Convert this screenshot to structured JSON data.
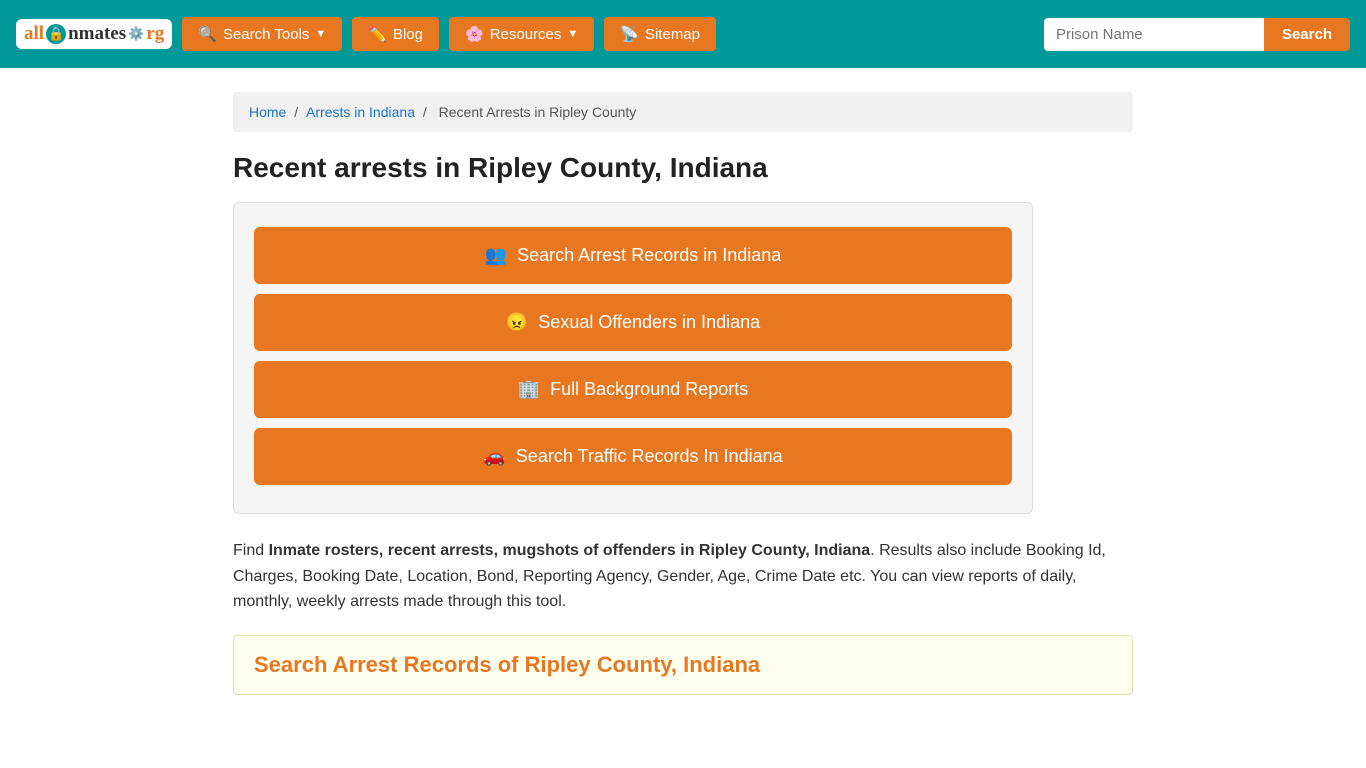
{
  "site": {
    "logo": {
      "all": "all",
      "inmates": "Inmates",
      "org": ".org"
    }
  },
  "navbar": {
    "search_tools_label": "Search Tools",
    "blog_label": "Blog",
    "resources_label": "Resources",
    "sitemap_label": "Sitemap",
    "search_placeholder": "Prison Name",
    "search_button": "Search"
  },
  "breadcrumb": {
    "home": "Home",
    "arrests_in_indiana": "Arrests in Indiana",
    "current": "Recent Arrests in Ripley County"
  },
  "page": {
    "title": "Recent arrests in Ripley County, Indiana"
  },
  "action_buttons": {
    "btn1": "Search Arrest Records in Indiana",
    "btn2": "Sexual Offenders in Indiana",
    "btn3": "Full Background Reports",
    "btn4": "Search Traffic Records In Indiana"
  },
  "description": {
    "intro": "Find ",
    "bold1": "Inmate rosters, recent arrests, mugshots of offenders in Ripley County, Indiana",
    "body": ". Results also include Booking Id, Charges, Booking Date, Location, Bond, Reporting Agency, Gender, Age, Crime Date etc. You can view reports of daily, monthly, weekly arrests made through this tool."
  },
  "section": {
    "heading": "Search Arrest Records of Ripley County, Indiana"
  }
}
